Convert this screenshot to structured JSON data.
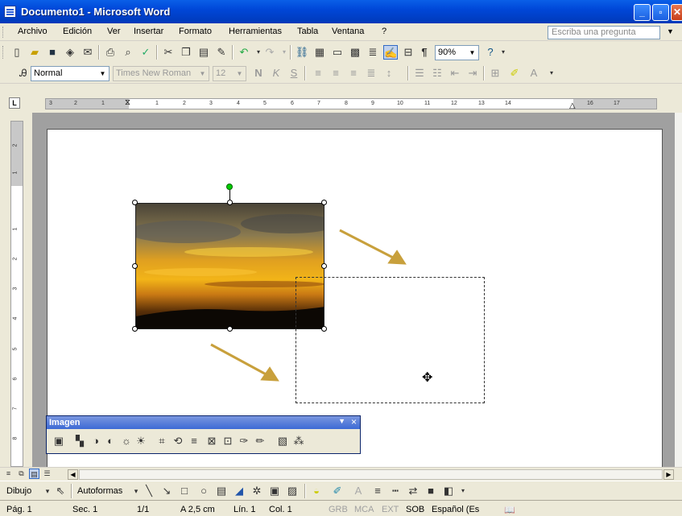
{
  "window": {
    "title": "Documento1 - Microsoft Word",
    "minimize": "_",
    "maximize": "▫",
    "close": "✕"
  },
  "menubar": {
    "items": [
      "Archivo",
      "Edición",
      "Ver",
      "Insertar",
      "Formato",
      "Herramientas",
      "Tabla",
      "Ventana",
      "?"
    ],
    "ask_placeholder": "Escriba una pregunta"
  },
  "toolbar_standard": {
    "zoom": "90%"
  },
  "toolbar_format": {
    "style": "Normal",
    "font": "Times New Roman",
    "size": "12"
  },
  "ruler": {
    "h_ticks": [
      "3",
      "2",
      "1",
      "1",
      "2",
      "3",
      "4",
      "5",
      "6",
      "7",
      "8",
      "9",
      "10",
      "11",
      "12",
      "13",
      "14",
      "16",
      "17"
    ],
    "v_ticks": [
      "2",
      "1",
      "1",
      "2",
      "3",
      "4",
      "5",
      "6",
      "7",
      "8"
    ]
  },
  "picture_toolbar": {
    "title": "Imagen"
  },
  "drawing_toolbar": {
    "draw_label": "Dibujo",
    "autoshapes_label": "Autoformas"
  },
  "statusbar": {
    "page": "Pág. 1",
    "section": "Sec. 1",
    "count": "1/1",
    "at": "A 2,5 cm",
    "line": "Lín. 1",
    "col": "Col. 1",
    "grb": "GRB",
    "mca": "MCA",
    "ext": "EXT",
    "sob": "SOB",
    "lang": "Español (Es"
  },
  "colors": {
    "titlebar": "#0047d8",
    "arrow": "#c8a03c",
    "rotation_handle": "#00cc00"
  }
}
